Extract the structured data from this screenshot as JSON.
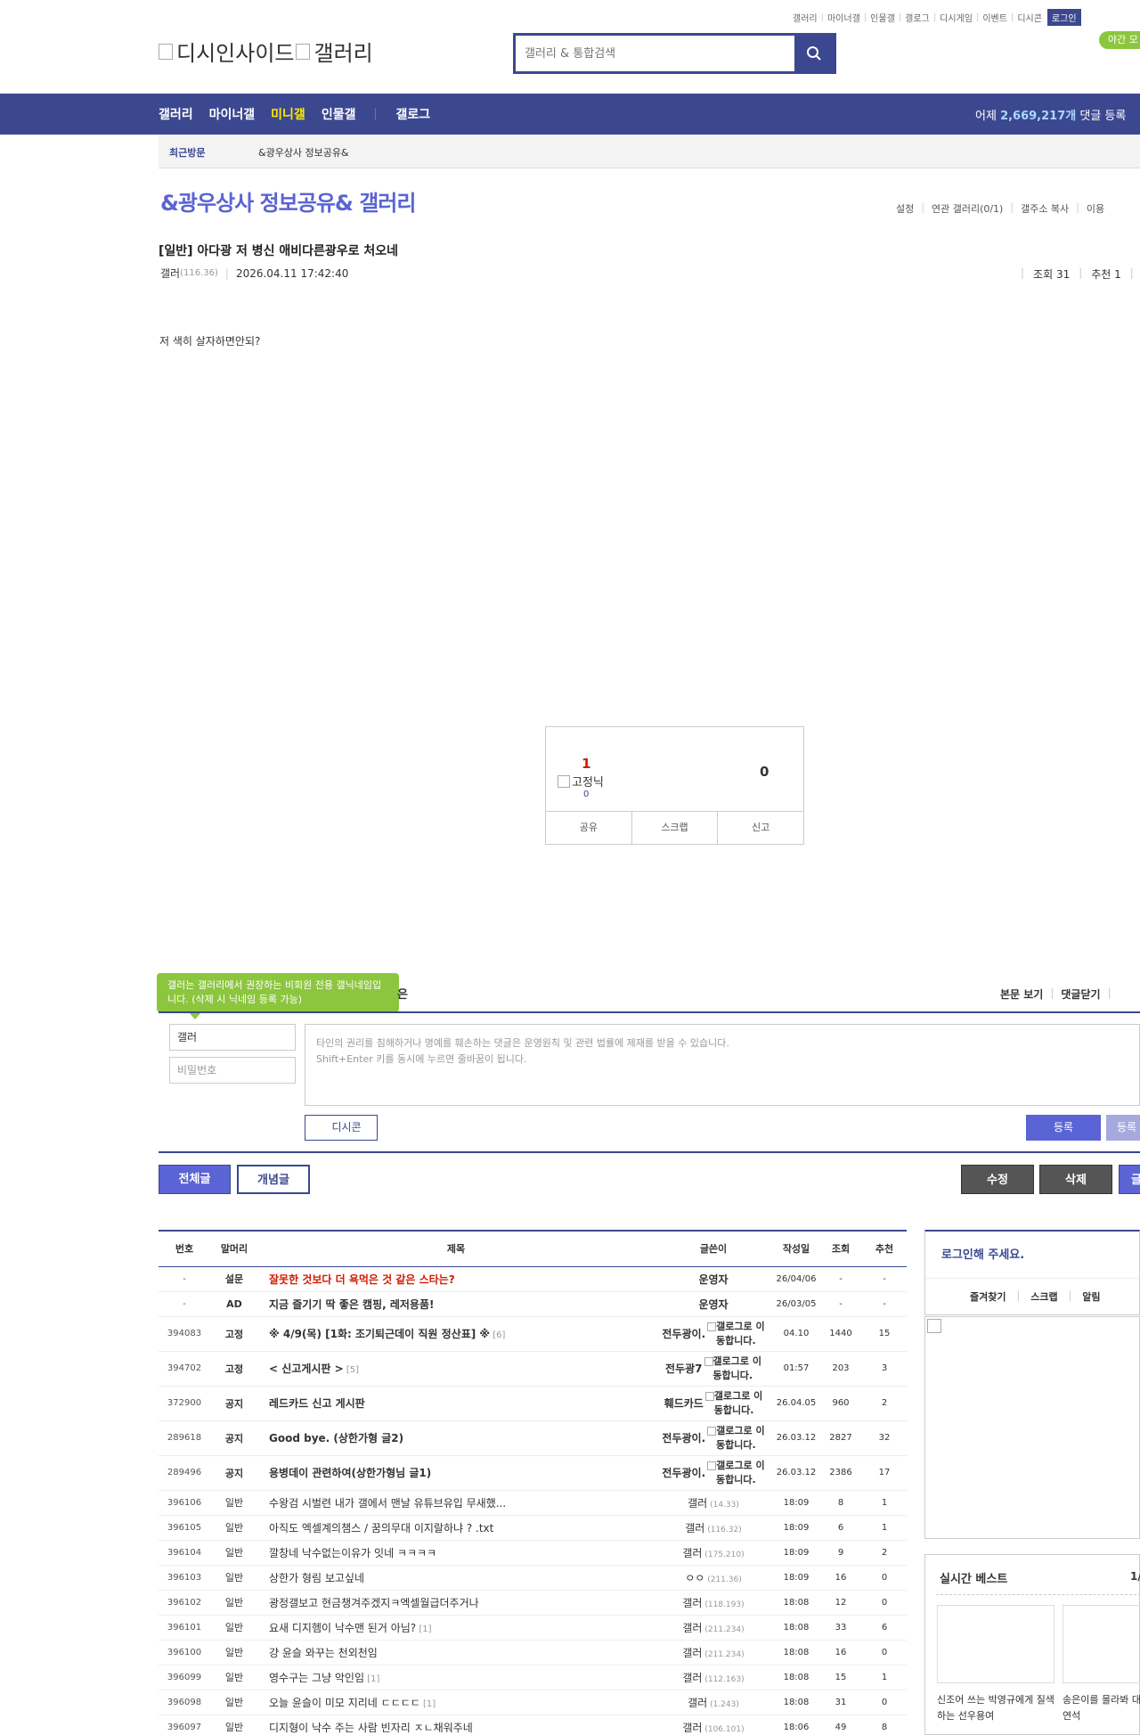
{
  "header": {
    "top_links": [
      "갤러리",
      "마이너갤",
      "인물갤",
      "갤로그",
      "디시게임",
      "이벤트",
      "디시콘"
    ],
    "login_label": "로그인",
    "night_label": "야간 모",
    "logo_text_1": "디시인사이드",
    "logo_text_2": "갤러리",
    "search_placeholder": "갤러리 & 통합검색"
  },
  "nav": {
    "items": [
      "갤러리",
      "마이너갤",
      "미니갤",
      "인물갤",
      "갤로그"
    ],
    "active_index": 2,
    "stats_prefix": "어제",
    "stats_count": "2,669,217개",
    "stats_suffix": "댓글 등록"
  },
  "recent": {
    "label": "최근방문",
    "item": "&광우상사 정보공유&"
  },
  "gallery": {
    "title": "&광우상사 정보공유& 갤러리",
    "links": [
      "설정",
      "연관 갤러리(0/1)",
      "갤주소 복사",
      "이용"
    ]
  },
  "post": {
    "title": "[일반] 아다광 저 병신 애비다른광우로 처오네",
    "writer": "갤러",
    "writer_ip": "(116.36)",
    "datetime": "2026.04.11 17:42:40",
    "views": "조회 31",
    "recommends": "추천 1",
    "body": "저 색히 살자하면안되?"
  },
  "recommend": {
    "up_count": "1",
    "fix_label": "고정닉",
    "fix_count": "0",
    "down_count": "0",
    "actions": [
      "공유",
      "스크랩",
      "신고"
    ]
  },
  "comment": {
    "tooltip": "갤러는 갤러리에서 권장하는 비회원 전용 갤닉네임입니다. (삭제 시 닉네임 등록 가능)",
    "tooltip_tail": "은",
    "view_links": [
      "본문 보기",
      "댓글닫기"
    ],
    "name_value": "갤러",
    "password_placeholder": "비밀번호",
    "textarea_line1": "타인의 권리를 침해하거나 명예를 훼손하는 댓글은 운영원칙 및 관련 법률에 제재를 받을 수 있습니다.",
    "textarea_line2": "Shift+Enter 키를 동시에 누르면 줄바꿈이 됩니다.",
    "dccon_label": "디시콘",
    "submit_label": "등록",
    "submit2_label": "등록"
  },
  "list_controls": {
    "tab_all": "전체글",
    "tab_concept": "개념글",
    "edit": "수정",
    "delete": "삭제",
    "write": "글"
  },
  "table": {
    "headers": [
      "번호",
      "말머리",
      "제목",
      "글쓴이",
      "작성일",
      "조회",
      "추천"
    ],
    "gallog_line1": "갤로그로 이",
    "gallog_line2": "동합니다.",
    "rows": [
      {
        "num": "-",
        "head": "설문",
        "subject": "잘못한 것보다 더 욕먹은 것 같은 스타는?",
        "reply": "",
        "writer": "운영자",
        "ip": "",
        "date": "26/04/06",
        "views": "-",
        "rec": "-",
        "type": "survey"
      },
      {
        "num": "-",
        "head": "AD",
        "subject": "지금 즐기기 딱 좋은 캠핑, 레저용품!",
        "reply": "",
        "writer": "운영자",
        "ip": "",
        "date": "26/03/05",
        "views": "-",
        "rec": "-",
        "type": "notice"
      },
      {
        "num": "394083",
        "head": "고정",
        "subject": "※ 4/9(목) [1화: 조기퇴근데이 직원 정산표] ※",
        "reply": "[6]",
        "writer": "전두광이.",
        "ip": "",
        "date": "04.10",
        "views": "1440",
        "rec": "15",
        "type": "fixed"
      },
      {
        "num": "394702",
        "head": "고정",
        "subject": "< 신고게시판 >",
        "reply": "[5]",
        "writer": "전두광7",
        "ip": "",
        "date": "01:57",
        "views": "203",
        "rec": "3",
        "type": "fixed"
      },
      {
        "num": "372900",
        "head": "공지",
        "subject": "레드카드 신고 게시판",
        "reply": "",
        "writer": "훼드카드",
        "ip": "",
        "date": "26.04.05",
        "views": "960",
        "rec": "2",
        "type": "fixed"
      },
      {
        "num": "289618",
        "head": "공지",
        "subject": "Good bye. (상한가형 글2)",
        "reply": "",
        "writer": "전두광이.",
        "ip": "",
        "date": "26.03.12",
        "views": "2827",
        "rec": "32",
        "type": "fixed"
      },
      {
        "num": "289496",
        "head": "공지",
        "subject": "용병데이 관련하여(상한가형님 글1)",
        "reply": "",
        "writer": "전두광이.",
        "ip": "",
        "date": "26.03.12",
        "views": "2386",
        "rec": "17",
        "type": "fixed"
      },
      {
        "num": "396106",
        "head": "일반",
        "subject": "수왕검 시벌련 내가 갤에서 맨날 유튜브유입 무새했...",
        "reply": "",
        "writer": "갤러",
        "ip": "(14.33)",
        "date": "18:09",
        "views": "8",
        "rec": "1",
        "type": "normal"
      },
      {
        "num": "396105",
        "head": "일반",
        "subject": "아직도 엑셀계의챔스 / 꿈의무대 이지랄하냐 ? .txt",
        "reply": "",
        "writer": "갤러",
        "ip": "(116.32)",
        "date": "18:09",
        "views": "6",
        "rec": "1",
        "type": "normal"
      },
      {
        "num": "396104",
        "head": "일반",
        "subject": "깔창네 낙수없는이유가 잇네 ㅋㅋㅋㅋ",
        "reply": "",
        "writer": "갤러",
        "ip": "(175.210)",
        "date": "18:09",
        "views": "9",
        "rec": "2",
        "type": "normal"
      },
      {
        "num": "396103",
        "head": "일반",
        "subject": "상한가 형림 보고싶네",
        "reply": "",
        "writer": "ㅇㅇ",
        "ip": "(211.36)",
        "date": "18:09",
        "views": "16",
        "rec": "0",
        "type": "normal"
      },
      {
        "num": "396102",
        "head": "일반",
        "subject": "광정갤보고 현금챙겨주겠지ㅋ엑셀월급더주거나",
        "reply": "",
        "writer": "갤러",
        "ip": "(118.193)",
        "date": "18:08",
        "views": "12",
        "rec": "0",
        "type": "normal"
      },
      {
        "num": "396101",
        "head": "일반",
        "subject": "요새 디지헴이 낙수맨 된거 아님?",
        "reply": "[1]",
        "writer": "갤러",
        "ip": "(211.234)",
        "date": "18:08",
        "views": "33",
        "rec": "6",
        "type": "normal"
      },
      {
        "num": "396100",
        "head": "일반",
        "subject": "걍 윤슬 와꾸는 천외천임",
        "reply": "",
        "writer": "갤러",
        "ip": "(211.234)",
        "date": "18:08",
        "views": "16",
        "rec": "0",
        "type": "normal"
      },
      {
        "num": "396099",
        "head": "일반",
        "subject": "영수구는 그냥 악인임",
        "reply": "[1]",
        "writer": "갤러",
        "ip": "(112.163)",
        "date": "18:08",
        "views": "15",
        "rec": "1",
        "type": "normal"
      },
      {
        "num": "396098",
        "head": "일반",
        "subject": "오늘 윤슬이 미모 지리네 ㄷㄷㄷㄷ",
        "reply": "[1]",
        "writer": "갤러",
        "ip": "(1.243)",
        "date": "18:08",
        "views": "31",
        "rec": "0",
        "type": "normal"
      },
      {
        "num": "396097",
        "head": "일반",
        "subject": "디지형이 낙수 주는 사람 빈자리 ㅈㄴ채워주네",
        "reply": "",
        "writer": "갤러",
        "ip": "(106.101)",
        "date": "18:06",
        "views": "49",
        "rec": "8",
        "type": "normal"
      }
    ]
  },
  "sidebar": {
    "login_title": "로그인해 주세요.",
    "login_links": [
      "즐겨찾기",
      "스크랩",
      "알림"
    ],
    "best_title": "실시간 베스트",
    "best_page": "1/",
    "best_items": [
      {
        "caption": "신조어 쓰는 박영규에게 질색하는 선우용여"
      },
      {
        "caption": "송은이를 몰라봐 대죄 한 유연석"
      }
    ]
  },
  "colors": {
    "brand": "#3b4890",
    "accent": "#5a64d4",
    "notice_red": "#d31900",
    "green": "#8cc63f"
  }
}
